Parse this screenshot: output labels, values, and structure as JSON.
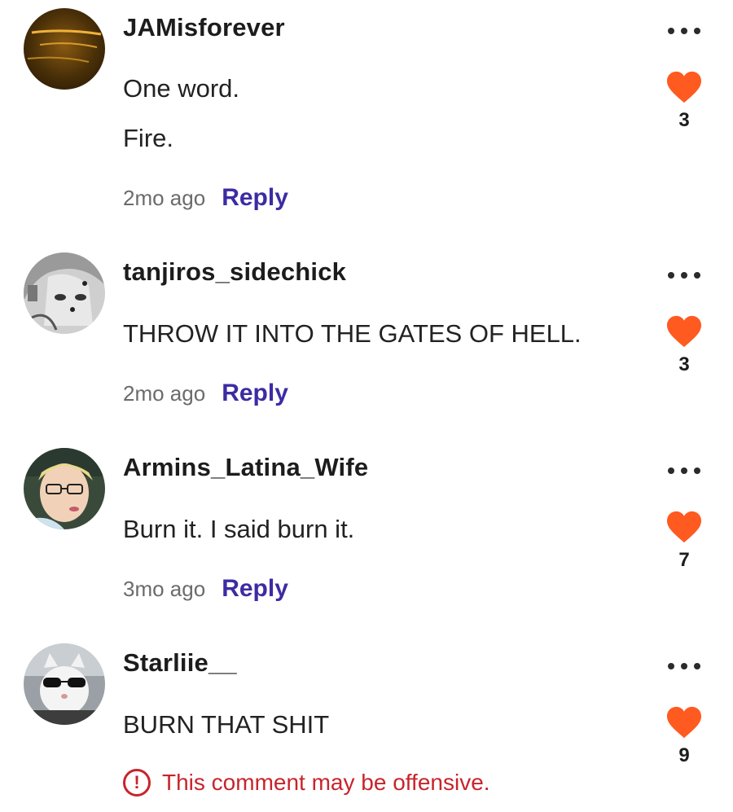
{
  "comments": [
    {
      "username": "JAMisforever",
      "lines": [
        "One word.",
        "Fire."
      ],
      "time": "2mo ago",
      "reply_label": "Reply",
      "likes": "3",
      "avatar": "dark-orange-blurred-photo"
    },
    {
      "username": "tanjiros_sidechick",
      "lines": [
        "THROW IT INTO THE GATES OF HELL."
      ],
      "time": "2mo ago",
      "reply_label": "Reply",
      "likes": "3",
      "avatar": "grayscale-manga-character"
    },
    {
      "username": "Armins_Latina_Wife",
      "lines": [
        "Burn it. I said burn it."
      ],
      "time": "3mo ago",
      "reply_label": "Reply",
      "likes": "7",
      "avatar": "person-with-glasses-photo"
    },
    {
      "username": "Starliie__",
      "lines": [
        "BURN THAT SHIT"
      ],
      "warning": "This comment may be offensive.",
      "likes": "9",
      "avatar": "cat-with-sunglasses-photo"
    }
  ],
  "colors": {
    "heart": "#ff5a1f",
    "reply": "#3d2ba3",
    "warning": "#c8242c",
    "meta": "#6b6b6b"
  },
  "icons": {
    "like": "heart-icon",
    "more": "more-options-icon",
    "warning": "exclamation-circle-icon"
  }
}
